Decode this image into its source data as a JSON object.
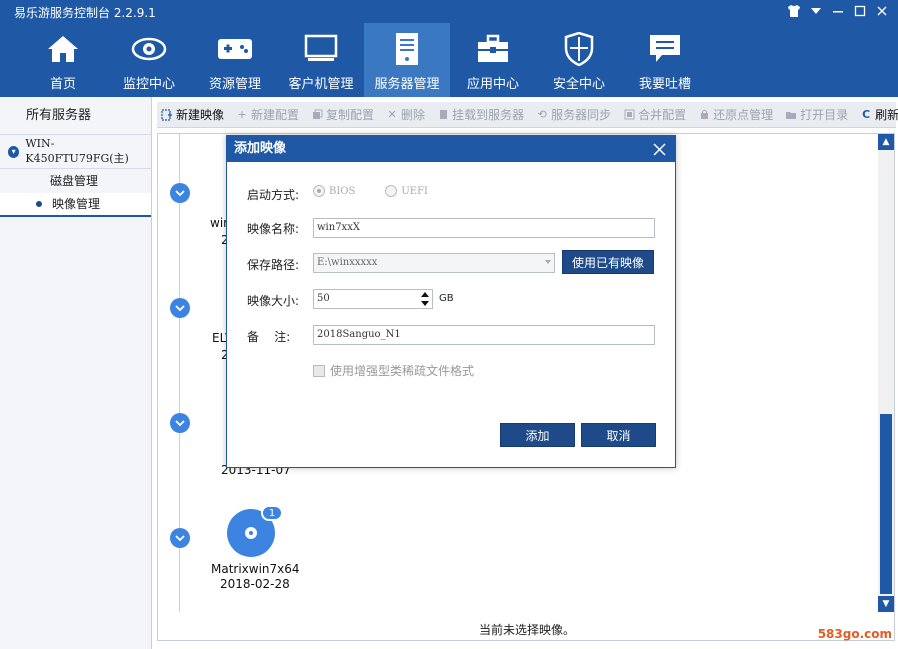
{
  "app": {
    "title": "易乐游服务控制台 2.2.9.1",
    "window_controls": [
      "shirt-icon",
      "minimize-icon",
      "maximize-icon",
      "close-icon"
    ]
  },
  "nav": {
    "items": [
      {
        "label": "首页",
        "icon": "home-icon"
      },
      {
        "label": "监控中心",
        "icon": "eye-icon"
      },
      {
        "label": "资源管理",
        "icon": "gamepad-icon"
      },
      {
        "label": "客户机管理",
        "icon": "monitor-icon"
      },
      {
        "label": "服务器管理",
        "icon": "server-icon",
        "active": true
      },
      {
        "label": "应用中心",
        "icon": "toolbox-icon"
      },
      {
        "label": "安全中心",
        "icon": "shield-icon"
      },
      {
        "label": "我要吐槽",
        "icon": "chat-icon"
      }
    ]
  },
  "sidebar": {
    "title": "所有服务器",
    "server": "WIN-K450FTU79FG(主)",
    "sub_items": [
      {
        "label": "磁盘管理"
      },
      {
        "label": "映像管理",
        "active": true
      }
    ]
  },
  "toolbar": {
    "items": [
      {
        "label": "新建映像",
        "icon": "new-image-icon",
        "enabled": true
      },
      {
        "label": "新建配置",
        "icon": "plus-icon",
        "enabled": false
      },
      {
        "label": "复制配置",
        "icon": "copy-icon",
        "enabled": false
      },
      {
        "label": "删除",
        "icon": "delete-icon",
        "enabled": false
      },
      {
        "label": "挂载到服务器",
        "icon": "mount-icon",
        "enabled": false
      },
      {
        "label": "服务器同步",
        "icon": "sync-icon",
        "enabled": false
      },
      {
        "label": "合并配置",
        "icon": "merge-icon",
        "enabled": false
      },
      {
        "label": "还原点管理",
        "icon": "restore-icon",
        "enabled": false
      },
      {
        "label": "打开目录",
        "icon": "folder-icon",
        "enabled": false
      },
      {
        "label": "刷新",
        "icon": "refresh-icon",
        "enabled": true
      }
    ]
  },
  "timeline": {
    "cards": [
      {
        "name": "wir",
        "date": "2"
      },
      {
        "name": "ELV",
        "date": "2"
      },
      {
        "name": "",
        "date": "2013-11-07"
      },
      {
        "name": "Matrixwin7x64",
        "date": "2018-02-28",
        "badge": "1"
      }
    ]
  },
  "status": "当前未选择映像。",
  "watermark": "583go.com",
  "dialog": {
    "title": "添加映像",
    "boot_label": "启动方式:",
    "boot_options": [
      {
        "label": "BIOS",
        "selected": true
      },
      {
        "label": "UEFI",
        "selected": false
      }
    ],
    "name_label": "映像名称:",
    "name_value": "win7xxX",
    "path_label": "保存路径:",
    "path_value": "E:\\winxxxxx",
    "use_existing_button": "使用已有映像",
    "size_label": "映像大小:",
    "size_value": "50",
    "size_unit": "GB",
    "note_label": "备    注:",
    "note_value": "2018Sanguo_N1",
    "sparse_checkbox": "使用增强型类稀疏文件格式",
    "add_button": "添加",
    "cancel_button": "取消"
  },
  "colors": {
    "brand": "#1f59a6",
    "accent": "#3d84e0",
    "button": "#1f4a8a"
  }
}
